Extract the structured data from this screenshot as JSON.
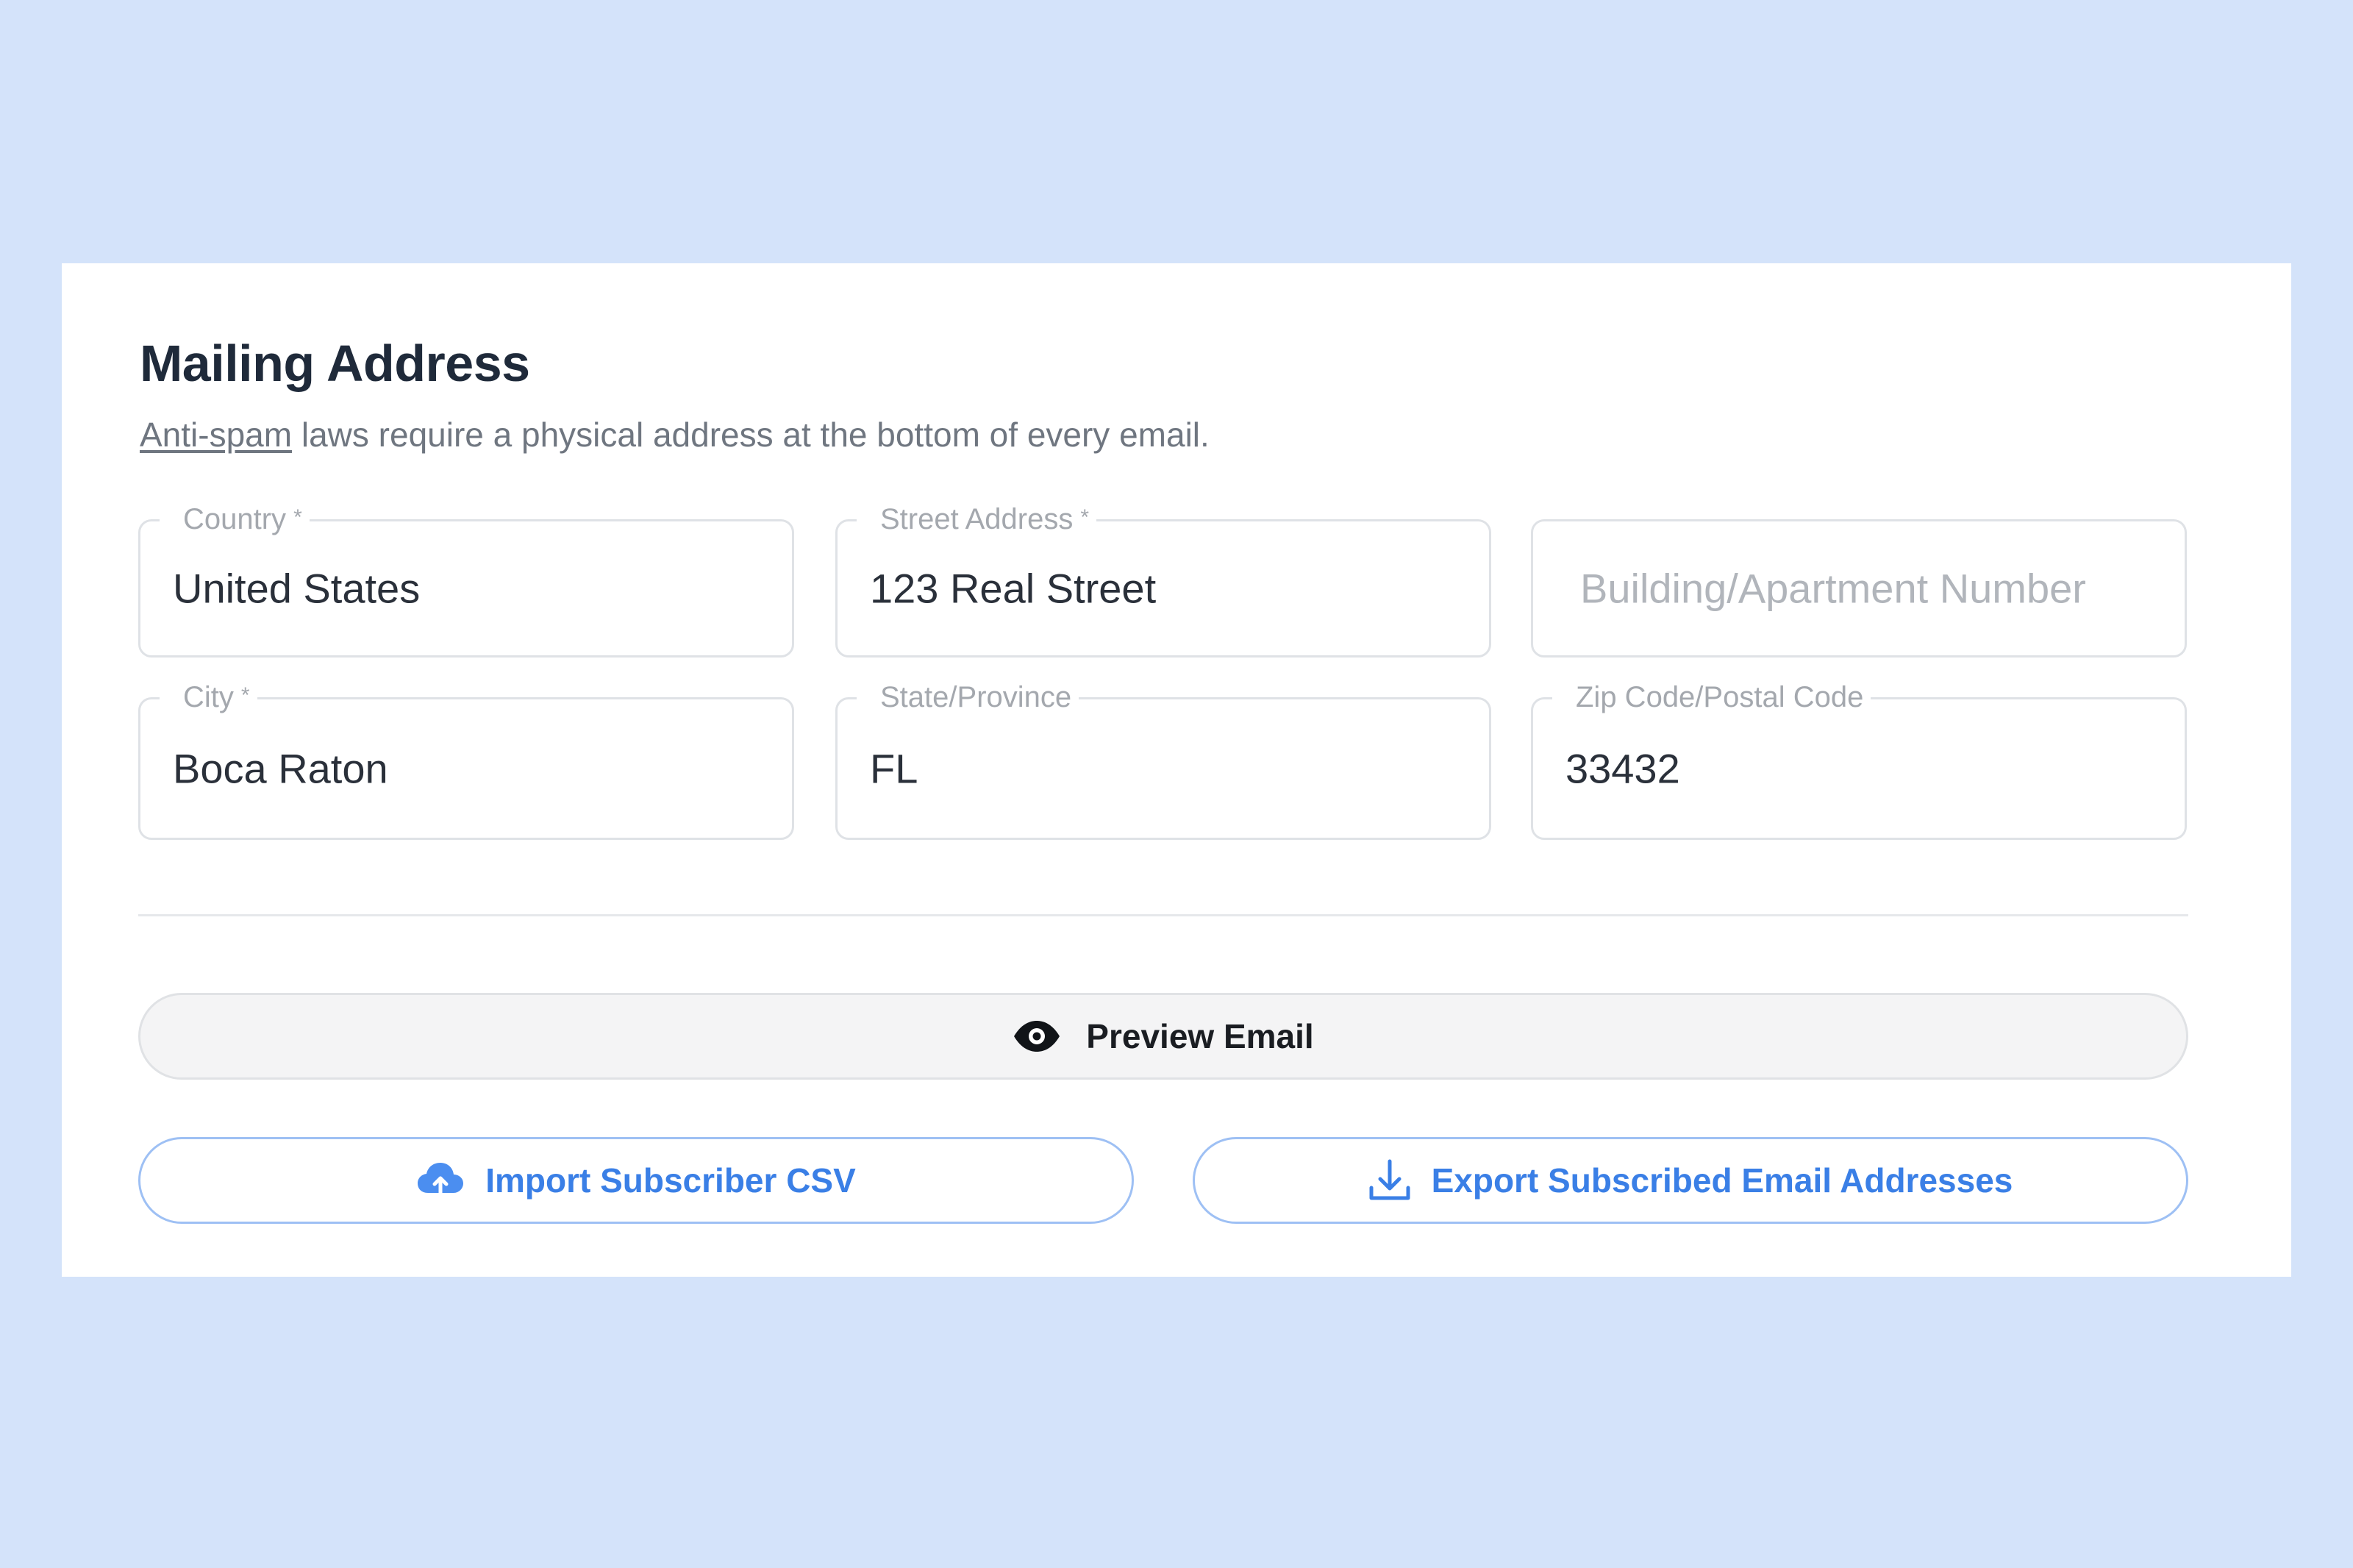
{
  "section": {
    "title": "Mailing Address",
    "subtitle_link": "Anti-spam",
    "subtitle_rest": " laws require a physical address at the bottom of every email."
  },
  "fields": {
    "country": {
      "label": "Country",
      "required_mark": "*",
      "value": "United States"
    },
    "street": {
      "label": "Street Address",
      "required_mark": "*",
      "value": "123 Real Street"
    },
    "building": {
      "placeholder": "Building/Apartment Number"
    },
    "city": {
      "label": "City",
      "required_mark": "*",
      "value": "Boca Raton"
    },
    "state": {
      "label": "State/Province",
      "value": "FL"
    },
    "zip": {
      "label": "Zip Code/Postal Code",
      "value": "33432"
    }
  },
  "actions": {
    "preview_label": "Preview Email",
    "import_label": "Import Subscriber CSV",
    "export_label": "Export Subscribed Email Addresses"
  },
  "icons": {
    "preview": "eye-icon",
    "import": "cloud-upload-icon",
    "export": "download-icon"
  },
  "colors": {
    "background": "#d4e3fa",
    "accent": "#3a7fe6",
    "accent_border": "#9ec0f4",
    "title": "#1f2a3a"
  }
}
